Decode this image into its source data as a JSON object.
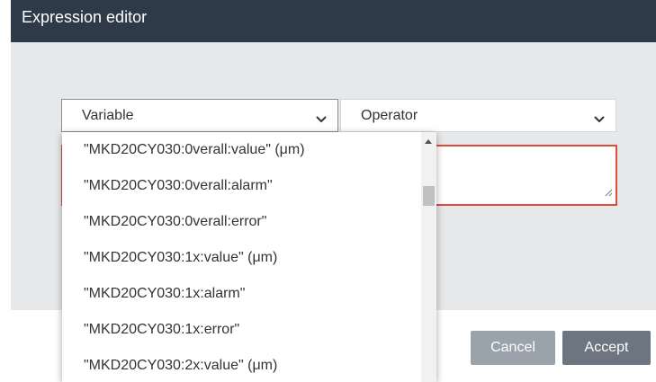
{
  "window": {
    "title": "Expression editor"
  },
  "variable_select": {
    "selected": "Variable",
    "icon": "chevron-down-icon"
  },
  "operator_select": {
    "selected": "Operator",
    "icon": "chevron-down-icon"
  },
  "expression_input": {
    "value": "",
    "border_color": "#e24b3c"
  },
  "variable_dropdown": {
    "items": [
      "\"MKD20CY030:0verall:value\" (μm)",
      "\"MKD20CY030:0verall:alarm\"",
      "\"MKD20CY030:0verall:error\"",
      "\"MKD20CY030:1x:value\" (μm)",
      "\"MKD20CY030:1x:alarm\"",
      "\"MKD20CY030:1x:error\"",
      "\"MKD20CY030:2x:value\" (μm)"
    ]
  },
  "buttons": {
    "cancel": "Cancel",
    "accept": "Accept"
  },
  "colors": {
    "title_bar": "#2f3a49",
    "panel": "#e7e8e9",
    "accept": "#6c7580",
    "cancel": "#9aa2ab"
  }
}
